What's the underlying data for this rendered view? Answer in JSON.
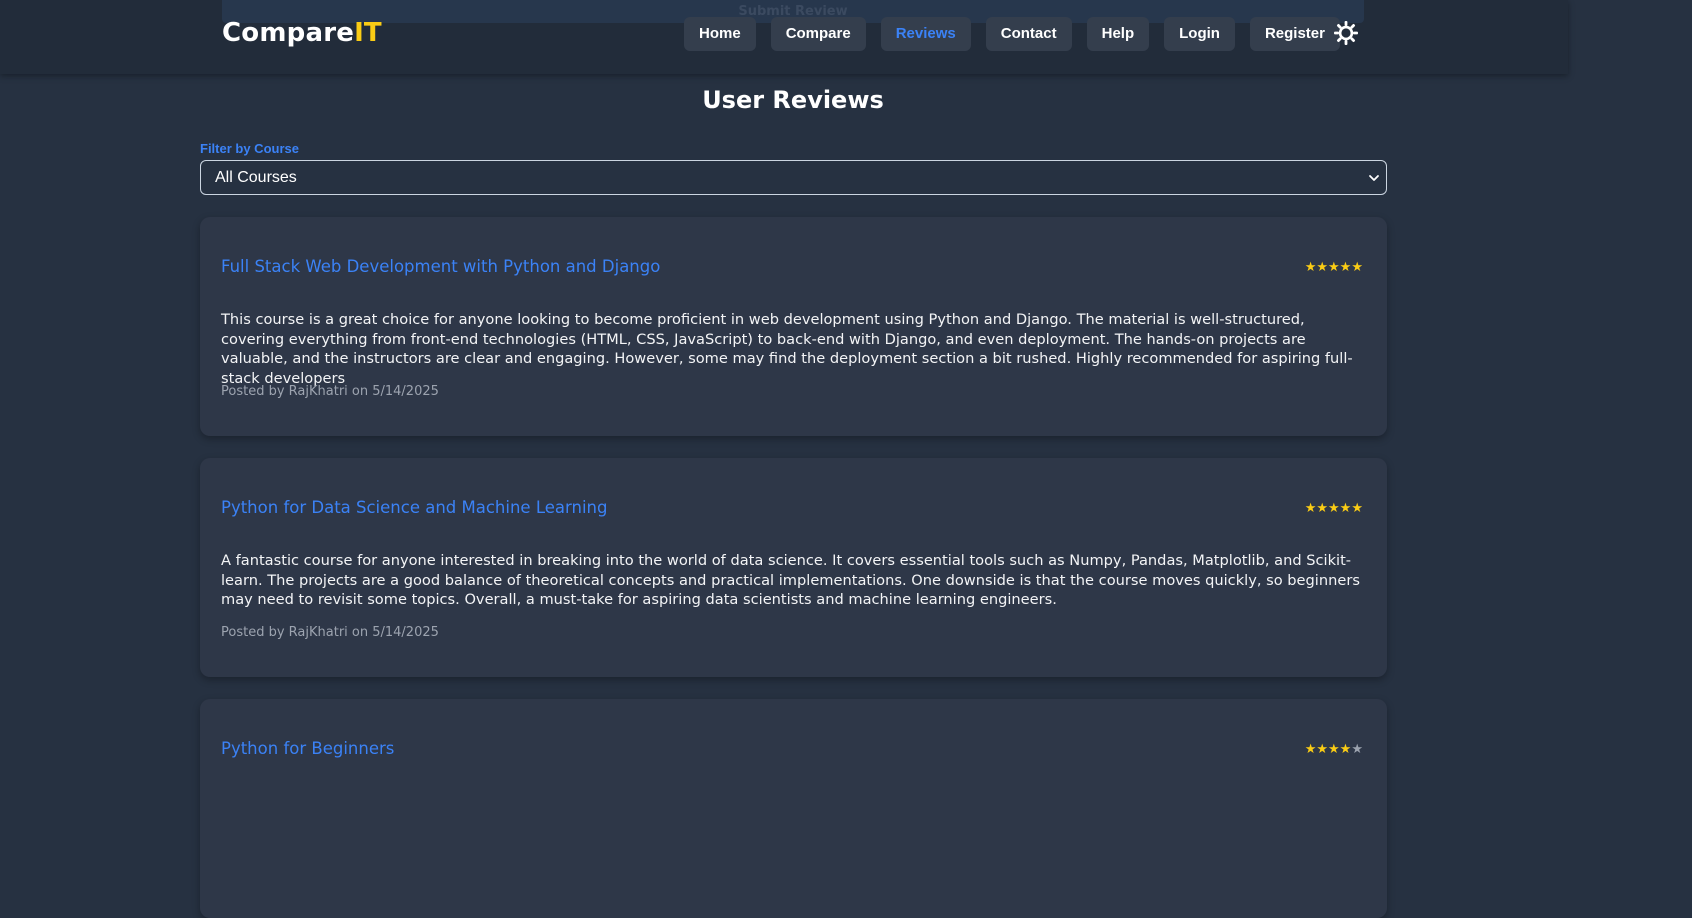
{
  "header": {
    "ghost_text": "Submit Review",
    "logo_main": "Compare",
    "logo_accent": "IT",
    "nav": [
      {
        "label": "Home"
      },
      {
        "label": "Compare"
      },
      {
        "label": "Reviews"
      },
      {
        "label": "Contact"
      },
      {
        "label": "Help"
      },
      {
        "label": "Login"
      },
      {
        "label": "Register"
      }
    ],
    "active_nav": "Reviews",
    "theme_icon": "sun-icon"
  },
  "main": {
    "title": "User Reviews",
    "filter": {
      "label": "Filter by Course",
      "selected": "All Courses"
    },
    "reviews": [
      {
        "course": "Full Stack Web Development with Python and Django",
        "rating": 5,
        "stars": "★★★★★",
        "body": "This course is a great choice for anyone looking to become proficient in web development using Python and Django. The material is well-structured, covering everything from front-end technologies (HTML, CSS, JavaScript) to back-end with Django, and even deployment. The hands-on projects are valuable, and the instructors are clear and engaging. However, some may find the deployment section a bit rushed. Highly recommended for aspiring full-stack developers",
        "meta": "Posted by RajKhatri on 5/14/2025"
      },
      {
        "course": "Python for Data Science and Machine Learning",
        "rating": 5,
        "stars": "★★★★★",
        "body": "A fantastic course for anyone interested in breaking into the world of data science. It covers essential tools such as Numpy, Pandas, Matplotlib, and Scikit-learn. The projects are a good balance of theoretical concepts and practical implementations. One downside is that the course moves quickly, so beginners may need to revisit some topics. Overall, a must-take for aspiring data scientists and machine learning engineers.",
        "meta": "Posted by RajKhatri on 5/14/2025"
      },
      {
        "course": "Python for Beginners",
        "rating": 4,
        "stars_on": "★★★★",
        "stars_off": "★"
      }
    ]
  },
  "colors": {
    "background": "#263141",
    "header": "#222c3a",
    "card": "#2e3748",
    "accent_blue": "#3b82f6",
    "accent_yellow": "#facc15"
  }
}
